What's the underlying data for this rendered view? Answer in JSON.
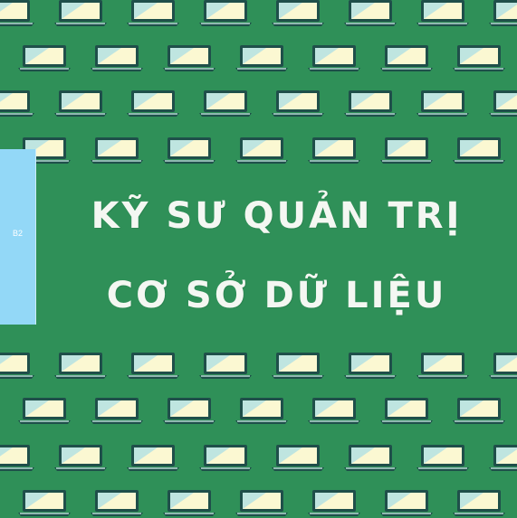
{
  "side_tab": {
    "label": "B2"
  },
  "title": {
    "line1": "KỸ SƯ QUẢN TRỊ",
    "line2": "CƠ SỞ DỮ LIỆU"
  },
  "colors": {
    "background": "#2f9058",
    "side_tab": "#93d8f7",
    "title_text": "#f4f7f2",
    "laptop_screen_light": "#fbf8d2",
    "laptop_screen_blue": "#bfe5e0",
    "laptop_frame": "#1f4f4a"
  },
  "icon": "laptop-icon"
}
